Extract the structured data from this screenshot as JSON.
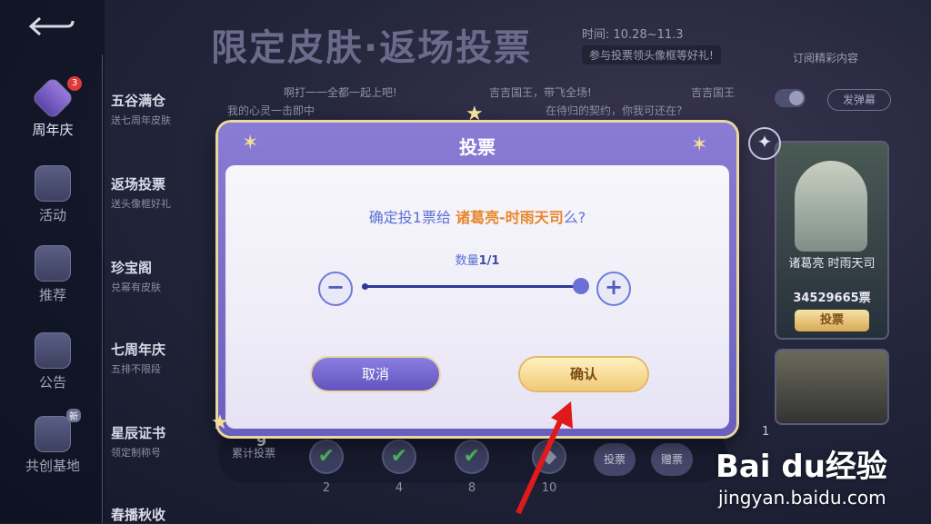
{
  "header": {
    "title": "限定皮肤·返场投票",
    "time": "时间: 10.28~11.3",
    "reward_tip": "参与投票领头像框等好礼!",
    "subscribe": "订阅精彩内容",
    "danmu_button": "发弹幕",
    "danmu": [
      "啊打一一全都一起上吧!",
      "吉吉国王，带飞全场!",
      "吉吉国王",
      "我的心灵一击即中",
      "在待归的契约，你我可还在?"
    ]
  },
  "nav": {
    "items": [
      {
        "label": "周年庆",
        "badge": "3"
      },
      {
        "label": "活动"
      },
      {
        "label": "推荐"
      },
      {
        "label": "公告"
      },
      {
        "label": "共创基地",
        "tag": "新"
      }
    ]
  },
  "submenu": [
    {
      "title": "五谷满仓",
      "desc": "送七周年皮肤"
    },
    {
      "title": "返场投票",
      "desc": "送头像框好礼"
    },
    {
      "title": "珍宝阁",
      "desc": "兑幂有皮肤"
    },
    {
      "title": "七周年庆",
      "desc": "五排不限段"
    },
    {
      "title": "星辰证书",
      "desc": "领定制称号"
    },
    {
      "title": "春播秋收",
      "desc": ""
    }
  ],
  "card": {
    "name": "诸葛亮 时雨天司",
    "votes": "34529665票",
    "vote_button": "投票"
  },
  "bottom": {
    "cum_count": "9",
    "cum_label": "累计投票",
    "milestones": [
      "2",
      "4",
      "8",
      "10"
    ],
    "vote_btn": "投票",
    "gift_btn": "赠票",
    "mini_value": "1"
  },
  "modal": {
    "title": "投票",
    "question_prefix": "确定投1票给",
    "question_target": "诸葛亮-时雨天司",
    "question_suffix": "么?",
    "quantity_label": "数量",
    "quantity_value": "1/1",
    "quantity_fraction": 1.0,
    "cancel": "取消",
    "confirm": "确认"
  },
  "watermark": {
    "brand": "Bai du经验",
    "url": "jingyan.baidu.com"
  },
  "colors": {
    "accent": "#6a5fbe",
    "highlight": "#e8862a",
    "gold": "#f1c977"
  }
}
